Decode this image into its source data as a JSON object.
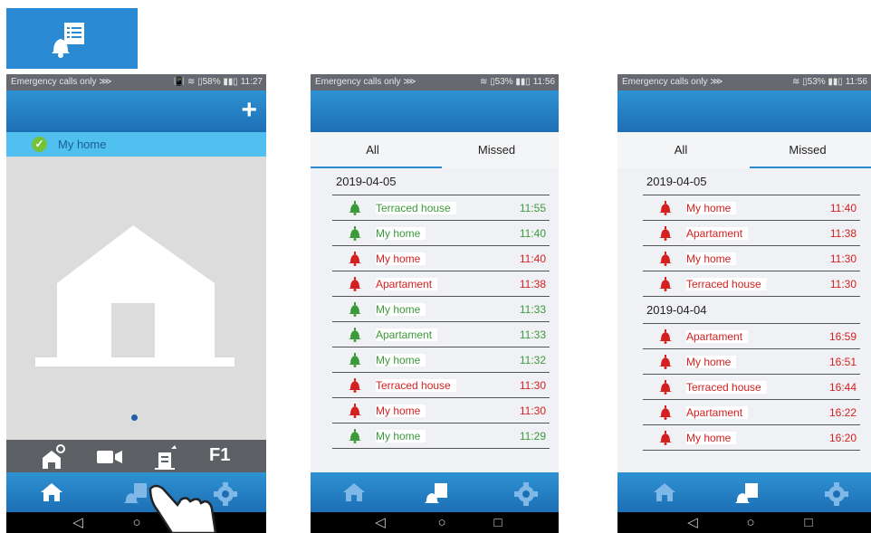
{
  "colors": {
    "brand_blue": "#2a8ad4",
    "answered_green": "#3a9a3a",
    "missed_red": "#d42020",
    "device_row": "#4fc0ef"
  },
  "screen1": {
    "status_left": "Emergency calls only ⋙",
    "status_right": "📳 ≋ ▯58% ▮▮▯ 11:27",
    "add_button": "+",
    "device_name": "My home",
    "function_label": "F1",
    "icons": [
      "house-settings-icon",
      "camera-icon",
      "door-light-icon",
      "home-icon",
      "call-log-icon",
      "gear-icon"
    ]
  },
  "screen2": {
    "status_left": "Emergency calls only ⋙",
    "status_right": "≋ ▯53% ▮▮▯ 11:56",
    "tabs": [
      "All",
      "Missed"
    ],
    "groups": [
      {
        "date": "2019-04-05",
        "entries": [
          {
            "name": "Terraced house",
            "time": "11:55",
            "status": "answered"
          },
          {
            "name": "My home",
            "time": "11:40",
            "status": "answered"
          },
          {
            "name": "My home",
            "time": "11:40",
            "status": "missed"
          },
          {
            "name": "Apartament",
            "time": "11:38",
            "status": "missed"
          },
          {
            "name": "My home",
            "time": "11:33",
            "status": "answered"
          },
          {
            "name": "Apartament",
            "time": "11:33",
            "status": "answered"
          },
          {
            "name": "My home",
            "time": "11:32",
            "status": "answered"
          },
          {
            "name": "Terraced house",
            "time": "11:30",
            "status": "missed"
          },
          {
            "name": "My home",
            "time": "11:30",
            "status": "missed"
          },
          {
            "name": "My home",
            "time": "11:29",
            "status": "answered"
          }
        ]
      }
    ]
  },
  "screen3": {
    "status_left": "Emergency calls only ⋙",
    "status_right": "≋ ▯53% ▮▮▯ 11:56",
    "tabs": [
      "All",
      "Missed"
    ],
    "groups": [
      {
        "date": "2019-04-05",
        "entries": [
          {
            "name": "My home",
            "time": "11:40",
            "status": "missed"
          },
          {
            "name": "Apartament",
            "time": "11:38",
            "status": "missed"
          },
          {
            "name": "My home",
            "time": "11:30",
            "status": "missed"
          },
          {
            "name": "Terraced house",
            "time": "11:30",
            "status": "missed"
          }
        ]
      },
      {
        "date": "2019-04-04",
        "entries": [
          {
            "name": "Apartament",
            "time": "16:59",
            "status": "missed"
          },
          {
            "name": "My home",
            "time": "16:51",
            "status": "missed"
          },
          {
            "name": "Terraced house",
            "time": "16:44",
            "status": "missed"
          },
          {
            "name": "Apartament",
            "time": "16:22",
            "status": "missed"
          },
          {
            "name": "My home",
            "time": "16:20",
            "status": "missed"
          }
        ]
      }
    ]
  },
  "system_nav": {
    "back": "◁",
    "home": "○",
    "recents": "□"
  }
}
